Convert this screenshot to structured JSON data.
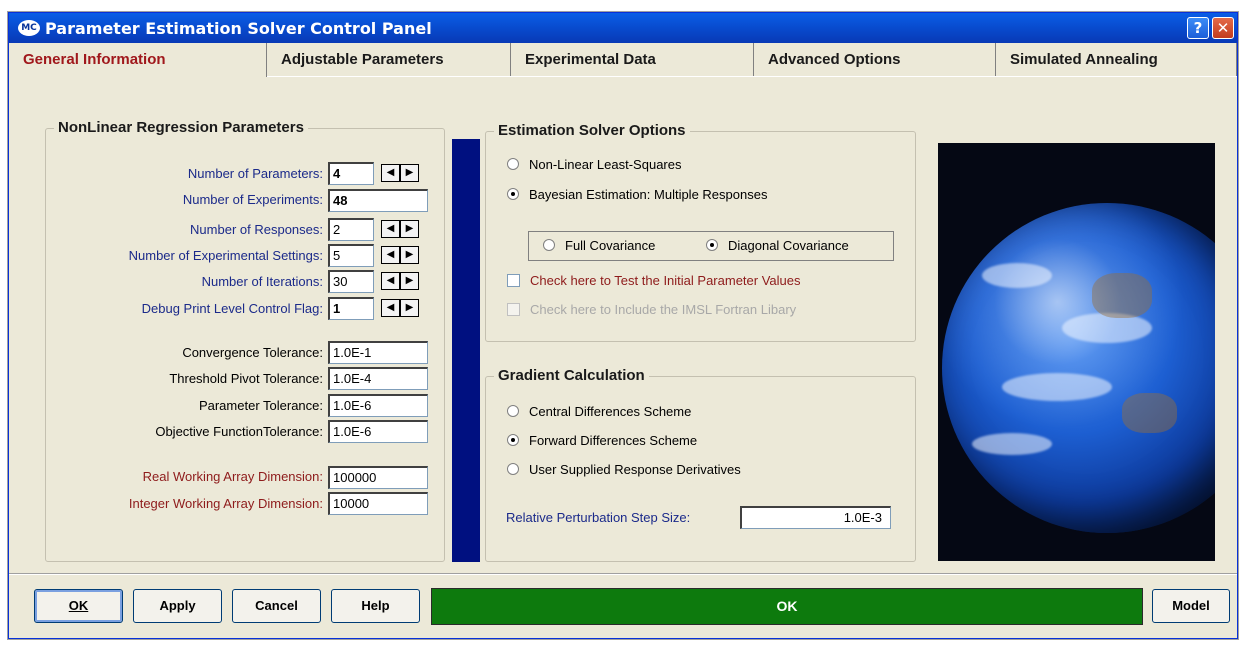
{
  "window": {
    "title": "Parameter Estimation Solver Control Panel",
    "icon_text": "MC",
    "help_label": "?",
    "close_label": "✕"
  },
  "tabs": [
    {
      "label": "General Information",
      "active": true
    },
    {
      "label": "Adjustable Parameters",
      "active": false
    },
    {
      "label": "Experimental Data",
      "active": false
    },
    {
      "label": "Advanced Options",
      "active": false
    },
    {
      "label": "Simulated Annealing",
      "active": false
    }
  ],
  "nonlinear": {
    "title": "NonLinear Regression  Parameters",
    "num_parameters": {
      "label": "Number of Parameters:",
      "value": "4"
    },
    "num_experiments": {
      "label": "Number of Experiments:",
      "value": "48"
    },
    "num_responses": {
      "label": "Number of Responses:",
      "value": "2"
    },
    "num_exp_settings": {
      "label": "Number of Experimental Settings:",
      "value": "5"
    },
    "num_iterations": {
      "label": "Number of Iterations:",
      "value": "30"
    },
    "debug_flag": {
      "label": "Debug Print Level Control Flag:",
      "value": "1"
    },
    "convergence_tol": {
      "label": "Convergence Tolerance:",
      "value": "1.0E-1"
    },
    "threshold_pivot_tol": {
      "label": "Threshold Pivot Tolerance:",
      "value": "1.0E-4"
    },
    "parameter_tol": {
      "label": "Parameter Tolerance:",
      "value": "1.0E-6"
    },
    "objective_tol": {
      "label": "Objective FunctionTolerance:",
      "value": "1.0E-6"
    },
    "real_array_dim": {
      "label": "Real Working Array Dimension:",
      "value": "100000"
    },
    "int_array_dim": {
      "label": "Integer Working Array Dimension:",
      "value": "10000"
    }
  },
  "spinner": {
    "left": "◀",
    "right": "▶"
  },
  "solver": {
    "title": "Estimation Solver Options",
    "nonlinear_ls": "Non-Linear Least-Squares",
    "bayesian": "Bayesian Estimation: Multiple Responses",
    "full_cov": "Full Covariance",
    "diag_cov": "Diagonal Covariance",
    "test_initial": "Check here to Test the Initial Parameter Values",
    "imsl": "Check here to Include the IMSL Fortran Libary"
  },
  "gradient": {
    "title": "Gradient Calculation",
    "central": "Central Differences Scheme",
    "forward": "Forward Differences Scheme",
    "user": "User Supplied Response Derivatives",
    "step_label": "Relative Perturbation Step Size:",
    "step_value": "1.0E-3"
  },
  "buttons": {
    "ok": "OK",
    "apply": "Apply",
    "cancel": "Cancel",
    "help": "Help",
    "model": "Model"
  },
  "status": {
    "text": "OK",
    "color": "#0d7a0d"
  }
}
